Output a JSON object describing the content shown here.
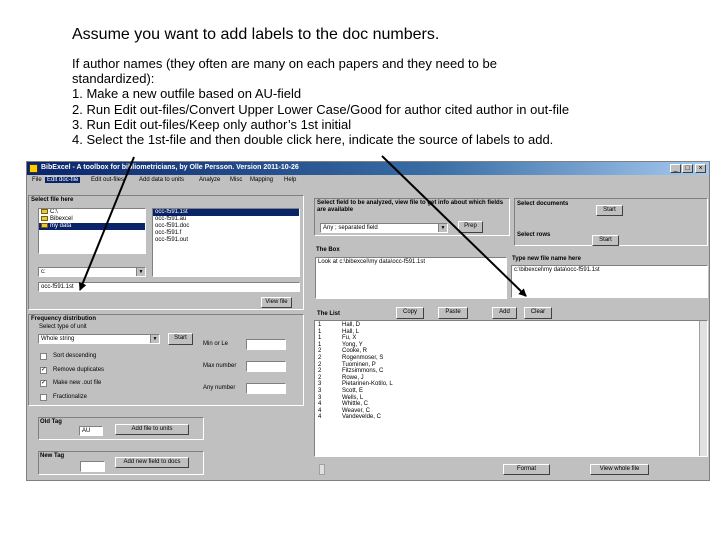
{
  "slide": {
    "title": "Assume you want to add labels to the doc numbers.",
    "lines": [
      "If author names (they often are many on each papers and they need to be",
      "standardized):",
      "1. Make a new outfile based on AU-field",
      "2. Run Edit out-files/Convert Upper Lower Case/Good for author cited author in out-file",
      "3. Run Edit out-files/Keep only author’s 1st initial",
      "4. Select the 1st-file and then double click here, indicate the source of labels to add."
    ]
  },
  "window": {
    "title": "BibExcel - A toolbox for bibliometricians, by Olle Persson. Version 2011-10-26",
    "controls": [
      "_",
      "□",
      "×"
    ],
    "menu": [
      "File",
      "Edit doc-file",
      "Edit out-files",
      "Add data to units",
      "Analyze",
      "Misc",
      "Mapping",
      "Help"
    ]
  },
  "left": {
    "select_file_label": "Select file here",
    "folders": [
      "C:\\",
      "Bibexcel",
      "my data"
    ],
    "files": [
      "occ-f591.1st",
      "occ-f591.au",
      "occ-f591.doc",
      "occ-f591.f",
      "occ-f591.out"
    ],
    "drive": "c:",
    "file_name": "occ-f591.1st",
    "view_file_button": "View file"
  },
  "freq": {
    "title": "Frequency distribution",
    "unit_label": "Select type of unit",
    "unit_value": "Whole string",
    "start_button": "Start",
    "sort_desc": "Sort descending",
    "remove_dup": "Remove duplicates",
    "make_new_file": "Make new .out file",
    "fractionalize": "Fractionalize",
    "min_label": "Min or Le",
    "max_label": "Max number",
    "any_label": "Any number"
  },
  "old_tag": {
    "label": "Old Tag",
    "value": "AU",
    "button": "Add file to units"
  },
  "new_tag": {
    "label": "New Tag",
    "value": "",
    "button": "Add new field to docs"
  },
  "right": {
    "select_field_label": "Select field to be analyzed, view file to get info about which fields are available",
    "field_value": "Any ; separated field",
    "prep_button": "Prep",
    "select_docs_label": "Select documents",
    "start_docs_button": "Start",
    "select_rows_label": "Select rows",
    "start_rows_button": "Start",
    "the_box_label": "The Box",
    "box_text": "Look at c:\\bibexcel\\my data\\occ-f591.1st",
    "new_file_label": "Type new file name here",
    "new_file_value": "c:\\bibexcel\\my data\\occ-f591.1st",
    "copy_button": "Copy",
    "paste_button": "Paste",
    "add_button": "Add",
    "clear_button": "Clear",
    "the_list_label": "The List",
    "list": [
      {
        "n": "1",
        "name": "Hall, D"
      },
      {
        "n": "1",
        "name": "Hall, L"
      },
      {
        "n": "1",
        "name": "Fu, X"
      },
      {
        "n": "1",
        "name": "Yong, Y"
      },
      {
        "n": "2",
        "name": "Cooke, R"
      },
      {
        "n": "2",
        "name": "Rogenmoser, S"
      },
      {
        "n": "2",
        "name": "Tuominen, P"
      },
      {
        "n": "2",
        "name": "Fitzsimmons, C"
      },
      {
        "n": "2",
        "name": "Rowe, J"
      },
      {
        "n": "3",
        "name": "Pietarinen-Kotilo, L"
      },
      {
        "n": "3",
        "name": "Scott, E"
      },
      {
        "n": "3",
        "name": "Wells, L"
      },
      {
        "n": "4",
        "name": "Whittle, C"
      },
      {
        "n": "4",
        "name": "Weaver, C"
      },
      {
        "n": "4",
        "name": "Vandevelde, C"
      }
    ],
    "format_button": "Format",
    "view_whole_file_button": "View whole file"
  }
}
